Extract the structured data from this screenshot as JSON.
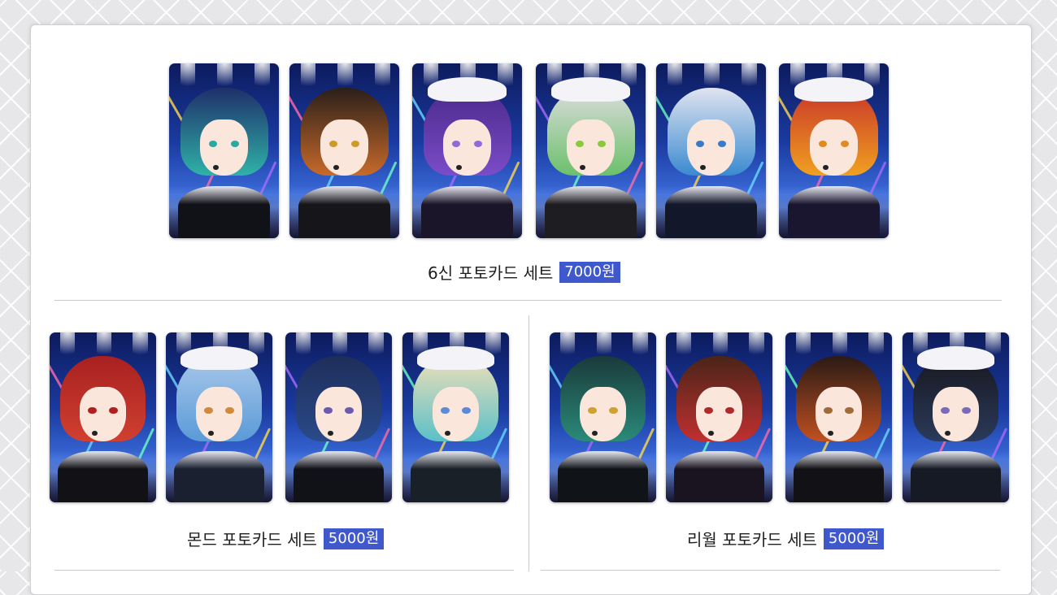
{
  "sets": [
    {
      "name": "6신 포토카드 세트",
      "price": "7000원",
      "cards": [
        {
          "hair": "#1f2f6a",
          "accent": "#2fb2a8",
          "body": "#111218",
          "eye": "#2aa9a0",
          "hat": false
        },
        {
          "hair": "#2a1f1a",
          "accent": "#c86a2a",
          "body": "#15151a",
          "eye": "#d09a2a",
          "hat": false
        },
        {
          "hair": "#4a2a8a",
          "accent": "#7b4cc8",
          "body": "#1a1528",
          "eye": "#8f6bd8",
          "hat": true
        },
        {
          "hair": "#dcdcdc",
          "accent": "#6bc06b",
          "body": "#1d1d22",
          "eye": "#8bc83a",
          "hat": true
        },
        {
          "hair": "#dfe4f0",
          "accent": "#3a8ad0",
          "body": "#12172a",
          "eye": "#3a7ac8",
          "hat": false
        },
        {
          "hair": "#c8362a",
          "accent": "#f0a020",
          "body": "#1a1630",
          "eye": "#e08a20",
          "hat": true
        }
      ]
    },
    {
      "name": "몬드 포토카드 세트",
      "price": "5000원",
      "cards": [
        {
          "hair": "#a82020",
          "accent": "#d04030",
          "body": "#111116",
          "eye": "#b02020",
          "hat": false
        },
        {
          "hair": "#a8c8ea",
          "accent": "#5a9ad8",
          "body": "#1a2030",
          "eye": "#d08a3a",
          "hat": true
        },
        {
          "hair": "#1e2e5a",
          "accent": "#2a4a8a",
          "body": "#101218",
          "eye": "#6a5ab0",
          "hat": false
        },
        {
          "hair": "#efe0b8",
          "accent": "#5ac0c8",
          "body": "#1a2028",
          "eye": "#5a8ad8",
          "hat": true
        }
      ]
    },
    {
      "name": "리월 포토카드 세트",
      "price": "5000원",
      "cards": [
        {
          "hair": "#1a3a3a",
          "accent": "#2a8a7a",
          "body": "#101418",
          "eye": "#d0a030",
          "hat": false
        },
        {
          "hair": "#4a2418",
          "accent": "#c03030",
          "body": "#1a1420",
          "eye": "#b02a2a",
          "hat": false
        },
        {
          "hair": "#2a1a16",
          "accent": "#c05020",
          "body": "#121216",
          "eye": "#a06a3a",
          "hat": false
        },
        {
          "hair": "#181820",
          "accent": "#2a3a5a",
          "body": "#161a24",
          "eye": "#7a6ab8",
          "hat": true
        }
      ]
    }
  ]
}
